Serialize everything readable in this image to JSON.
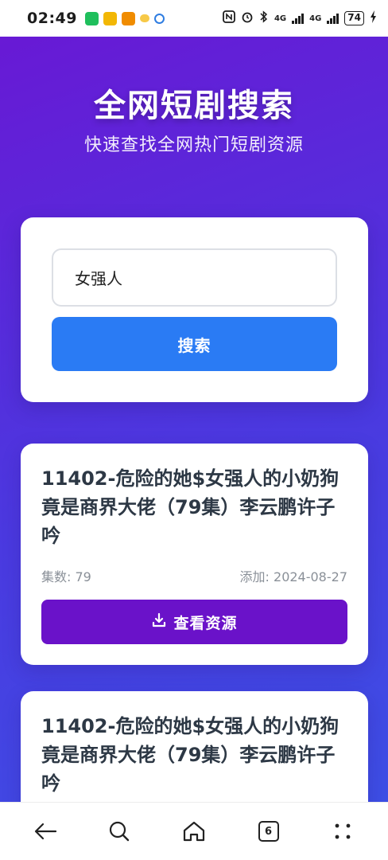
{
  "status_bar": {
    "time": "02:49",
    "battery": "74",
    "network": [
      "4G",
      "4G"
    ],
    "app_icons": [
      {
        "name": "wechat-icon",
        "color": "#1fbf5c"
      },
      {
        "name": "app-yellow-icon",
        "color": "#f2b705"
      },
      {
        "name": "app-orange-icon",
        "color": "#f08c00"
      },
      {
        "name": "app-small-yellow-icon",
        "color": "#f7c948"
      },
      {
        "name": "app-chat-icon",
        "color": "#2f7de1"
      }
    ]
  },
  "header": {
    "title": "全网短剧搜索",
    "subtitle": "快速查找全网热门短剧资源"
  },
  "search": {
    "value": "女强人",
    "button_label": "搜索"
  },
  "results": [
    {
      "title": "11402-危险的她$女强人的小奶狗竟是商界大佬（79集）李云鹏许子吟",
      "episodes": "集数: 79",
      "added": "添加: 2024-08-27",
      "button_label": "查看资源"
    },
    {
      "title": "11402-危险的她$女强人的小奶狗竟是商界大佬（79集）李云鹏许子吟"
    }
  ],
  "bottom_nav": {
    "tab_count": "6"
  },
  "colors": {
    "background_start": "#6a17d4",
    "background_end": "#3b52e6",
    "search_button": "#2a7bf4",
    "view_button": "#6a12c9"
  }
}
